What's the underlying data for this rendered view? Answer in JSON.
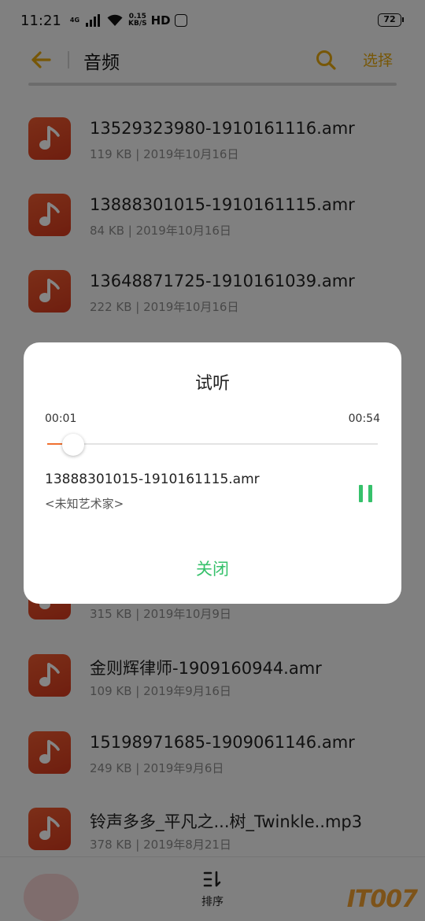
{
  "status_bar": {
    "time": "11:21",
    "network": "4G",
    "speed_value": "0.15",
    "speed_unit": "KB/S",
    "hd": "HD",
    "battery": "72"
  },
  "header": {
    "title": "音频",
    "select_label": "选择",
    "accent_color": "#e5a70e"
  },
  "files": [
    {
      "name": "13529323980-1910161116.amr",
      "size": "119 KB",
      "date": "2019年10月16日"
    },
    {
      "name": "13888301015-1910161115.amr",
      "size": "84 KB",
      "date": "2019年10月16日"
    },
    {
      "name": "13648871725-1910161039.amr",
      "size": "222 KB",
      "date": "2019年10月16日"
    },
    {
      "name": "",
      "size": "315 KB",
      "date": "2019年10月9日"
    },
    {
      "name": "金则辉律师-1909160944.amr",
      "size": "109 KB",
      "date": "2019年9月16日"
    },
    {
      "name": "15198971685-1909061146.amr",
      "size": "249 KB",
      "date": "2019年9月6日"
    },
    {
      "name": "铃声多多_平凡之...树_Twinkle..mp3",
      "size": "378 KB",
      "date": "2019年8月21日"
    }
  ],
  "bottom_bar": {
    "sort_label": "排序",
    "watermark": "IT007"
  },
  "dialog": {
    "title": "试听",
    "current_time": "00:01",
    "total_time": "00:54",
    "progress": 0.05,
    "track_name": "13888301015-1910161115.amr",
    "artist": "<未知艺术家>",
    "close_label": "关闭",
    "accent_color": "#36c16b",
    "progress_color": "#f07030"
  }
}
